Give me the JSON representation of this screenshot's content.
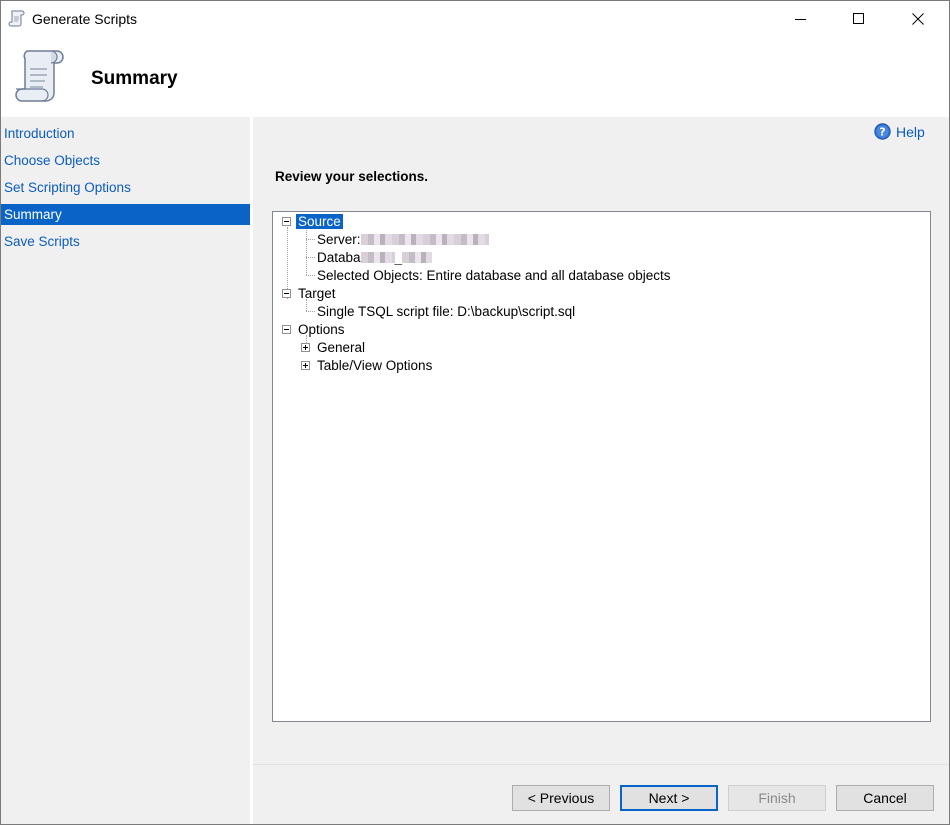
{
  "window": {
    "title": "Generate Scripts",
    "controls": {
      "minimize": "minimize",
      "maximize": "maximize",
      "close": "close"
    }
  },
  "header": {
    "title": "Summary",
    "icon": "scroll-icon"
  },
  "nav": {
    "items": [
      {
        "label": "Introduction",
        "active": false
      },
      {
        "label": "Choose Objects",
        "active": false
      },
      {
        "label": "Set Scripting Options",
        "active": false
      },
      {
        "label": "Summary",
        "active": true
      },
      {
        "label": "Save Scripts",
        "active": false
      }
    ]
  },
  "help": {
    "label": "Help"
  },
  "review_label": "Review your selections.",
  "tree": {
    "source": {
      "label": "Source",
      "server_label": "Server:",
      "database_label": "Databa",
      "database_tail": "_",
      "selected_objects": "Selected Objects: Entire database and all database objects"
    },
    "target": {
      "label": "Target",
      "file": "Single TSQL script file: D:\\backup\\script.sql"
    },
    "options": {
      "label": "Options",
      "children": [
        "General",
        "Table/View Options"
      ]
    }
  },
  "buttons": {
    "previous": "< Previous",
    "next": "Next >",
    "finish": "Finish",
    "cancel": "Cancel"
  },
  "colors": {
    "accent": "#0a64c8",
    "link": "#0b5cbf",
    "panel": "#f0f0f0"
  }
}
